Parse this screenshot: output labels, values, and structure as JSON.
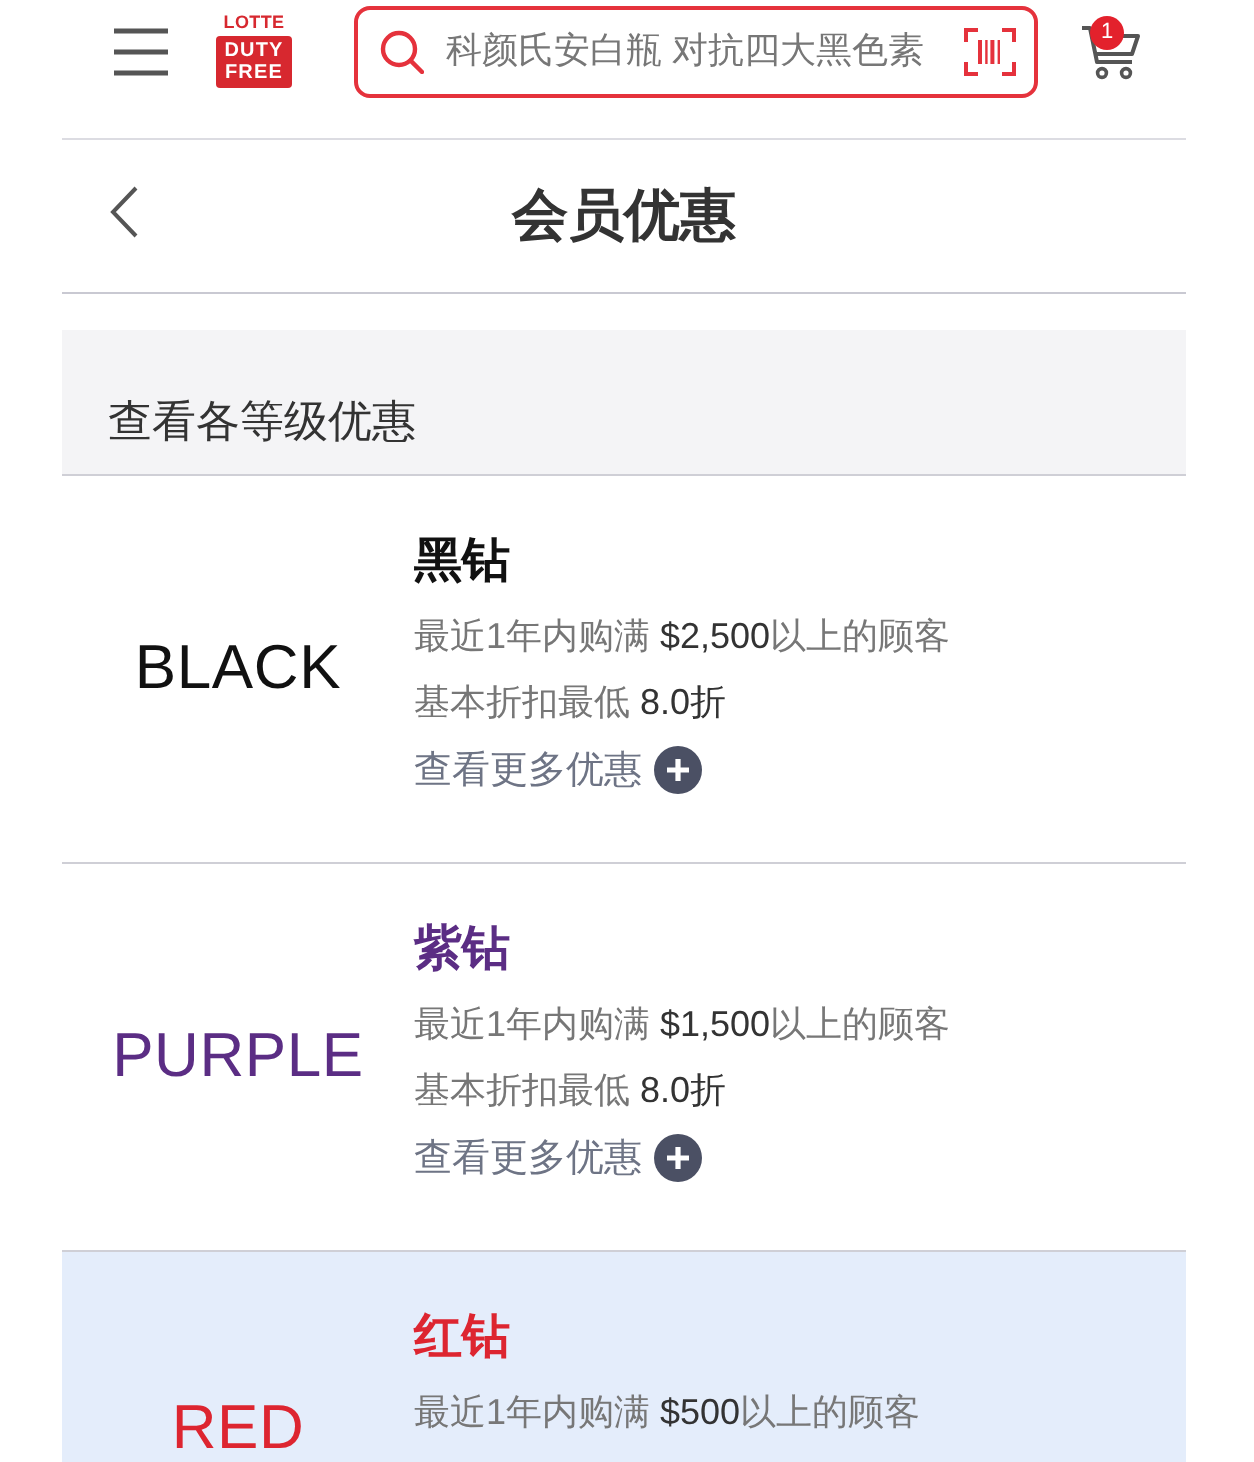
{
  "header": {
    "logo": {
      "top": "LOTTE",
      "badge": "DUTY FREE"
    },
    "search": {
      "placeholder": "科颜氏安白瓶 对抗四大黑色素"
    },
    "cart": {
      "count": "1"
    }
  },
  "nav": {
    "title": "会员优惠"
  },
  "section": {
    "title": "查看各等级优惠"
  },
  "tiers": [
    {
      "logo": "BLACK",
      "name": "黑钻",
      "color": "#111111",
      "selected": false,
      "lines": [
        "最近1年内购满 **$2,500**以上的顾客",
        "基本折扣最低 **8.0折**"
      ],
      "link": "查看更多优惠"
    },
    {
      "logo": "PURPLE",
      "name": "紫钻",
      "color": "#5b2d84",
      "selected": false,
      "lines": [
        "最近1年内购满 **$1,500**以上的顾客",
        "基本折扣最低 **8.0折**"
      ],
      "link": "查看更多优惠"
    },
    {
      "logo": "RED",
      "name": "红钻",
      "color": "#dd2530",
      "selected": true,
      "lines": [
        "最近1年内购满 **$500**以上的顾客"
      ]
    }
  ]
}
